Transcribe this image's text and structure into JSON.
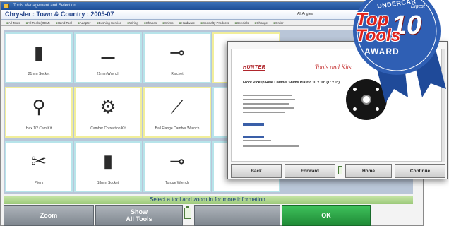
{
  "window": {
    "title": "Tools Management and Selection"
  },
  "header": {
    "vehicle": "Chrysler : Town & Country : 2005-07",
    "extra": "All Angles"
  },
  "filters": [
    "All Tools",
    "All Tools (OEM)",
    "Hand Tool",
    "Adapter",
    "Bushing Service",
    "Wiring",
    "Shapes",
    "Shims",
    "Hardware",
    "Specialty Products",
    "Specials",
    "Change",
    "Order"
  ],
  "tools": [
    {
      "label": "21mm Socket",
      "glyph": "▮"
    },
    {
      "label": "21mm Wrench",
      "glyph": "⚊"
    },
    {
      "label": "Ratchet",
      "glyph": "⊸"
    },
    {
      "label": "Hex 1/2 Cam Kit",
      "glyph": "⚲"
    },
    {
      "label": "Camber Correction Kit",
      "glyph": "⚙"
    },
    {
      "label": "Ball Flange Camber Wrench",
      "glyph": "⟋"
    },
    {
      "label": "Pliers",
      "glyph": "✂"
    },
    {
      "label": "18mm Socket",
      "glyph": "▮"
    },
    {
      "label": "Torque Wrench",
      "glyph": "⊸"
    }
  ],
  "status": "Select a tool and zoom in for more information.",
  "buttons": {
    "zoom": "Zoom",
    "show_all": "Show\nAll Tools",
    "ok": "OK"
  },
  "help_window": {
    "brand": "HUNTER",
    "subtitle": "Tools and Kits",
    "heading": "Front Pickup Rear Camber Shims Plastic 10 x 10° (1° x 1°)",
    "nav": {
      "back": "Back",
      "forward": "Forward",
      "home": "Home",
      "continue": "Continue"
    }
  },
  "award": {
    "publisher": "UNDERCAR",
    "publisher_sub": "Digest",
    "top": "Top",
    "ten": "10",
    "tools": "Tools",
    "label": "AWARD"
  },
  "colors": {
    "ok_button": "#1f8a36",
    "ribbon": "#2f5fb4",
    "award_red": "#e0231c"
  }
}
